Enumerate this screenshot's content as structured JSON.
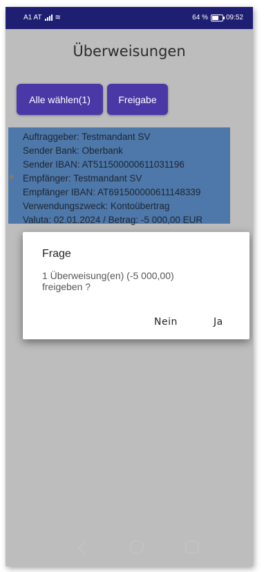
{
  "statusbar": {
    "carrier": "A1 AT",
    "battery_percent": "64 %",
    "time": "09:52",
    "icons": [
      "signal-icon",
      "wifi-icon",
      "battery-icon"
    ]
  },
  "page": {
    "title": "Überweisungen"
  },
  "toolbar": {
    "select_all_label": "Alle wählen(1)",
    "release_label": "Freigabe"
  },
  "transfer": {
    "client": "Auftraggeber: Testmandant SV",
    "sender_bank": "Sender Bank: Oberbank",
    "sender_iban": "Sender IBAN: AT511500000611031196",
    "recipient": "Empfänger: Testmandant SV",
    "recipient_iban": "Empfänger IBAN: AT691500000611148339",
    "purpose": "Verwendungszweck: Kontoübertrag",
    "value_amount": "Valuta: 02.01.2024 / Betrag: -5 000,00 EUR"
  },
  "dialog": {
    "title": "Frage",
    "message": "1 Überweisung(en) (-5 000,00) freigeben ?",
    "no_label": "Nein",
    "yes_label": "Ja"
  },
  "navigation": {
    "icons": [
      "back-icon",
      "home-icon",
      "recent-apps-icon"
    ]
  },
  "colors": {
    "statusbar": "#1e1f73",
    "button": "#4a38a6",
    "record_highlight": "#4d78a9",
    "dim_background": "#bdbdbd"
  }
}
